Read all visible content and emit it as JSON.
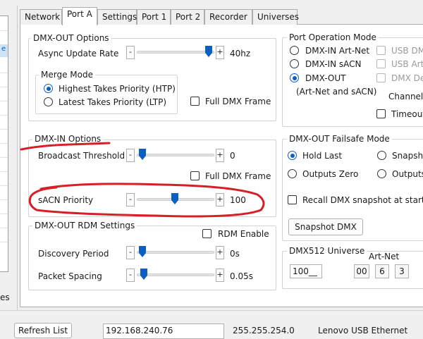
{
  "left_panel": {
    "visible_fragment": "e",
    "bottom_label_fragment": "es"
  },
  "tabs": [
    "Network",
    "Port A",
    "Settings",
    "Port 1",
    "Port 2",
    "Recorder",
    "Universes"
  ],
  "active_tab": "Port A",
  "dmx_out_options": {
    "title": "DMX-OUT Options",
    "async_update_rate": {
      "label": "Async Update Rate",
      "value": "40hz",
      "level": 0.92
    },
    "merge_mode": {
      "title": "Merge Mode",
      "htp_label": "Highest Takes Priority (HTP)",
      "ltp_label": "Latest Takes Priority (LTP)",
      "selected": "htp"
    },
    "full_dmx_frame_label": "Full DMX Frame"
  },
  "dmx_in_options": {
    "title": "DMX-IN Options",
    "broadcast_threshold": {
      "label": "Broadcast Threshold",
      "value": "0",
      "level": 0.0
    },
    "full_dmx_frame_label": "Full DMX Frame",
    "sacn_priority": {
      "label": "sACN Priority",
      "value": "100",
      "level": 0.5
    }
  },
  "rdm_settings": {
    "title": "DMX-OUT RDM Settings",
    "rdm_enable_label": "RDM Enable",
    "discovery_period": {
      "label": "Discovery Period",
      "value": "0s",
      "level": 0.0
    },
    "packet_spacing": {
      "label": "Packet Spacing",
      "value": "0.05s",
      "level": 0.02
    }
  },
  "port_operation_mode": {
    "title": "Port Operation Mode",
    "options": [
      "DMX-IN Art-Net",
      "DMX-IN sACN",
      "DMX-OUT"
    ],
    "selected_index": 2,
    "dmx_out_sub": "(Art-Net and sACN)",
    "right_checkboxes": [
      "USB DM",
      "USB Art",
      "DMX De"
    ],
    "channel_label": "Channel",
    "timeout_label": "Timeout"
  },
  "failsafe": {
    "title": "DMX-OUT Failsafe Mode",
    "hold_last_label": "Hold Last",
    "outputs_zero_label": "Outputs Zero",
    "snapshot_label": "Snapsho",
    "outputs_label": "Outputs",
    "selected": "hold_last",
    "recall_label": "Recall DMX snapshot at startup",
    "snapshot_button": "Snapshot DMX"
  },
  "dmx512_universe": {
    "title": "DMX512 Universe",
    "value": "100__",
    "artnet_label": "Art-Net",
    "artnet_values": [
      "00",
      "6",
      "3"
    ]
  },
  "bottom": {
    "refresh_button": "Refresh List",
    "ip_address": "192.168.240.76",
    "subnet_mask": "255.255.254.0",
    "adapter_name": "Lenovo USB Ethernet"
  },
  "colors": {
    "accent": "#0b5fc1",
    "annotation": "#d61f26"
  }
}
